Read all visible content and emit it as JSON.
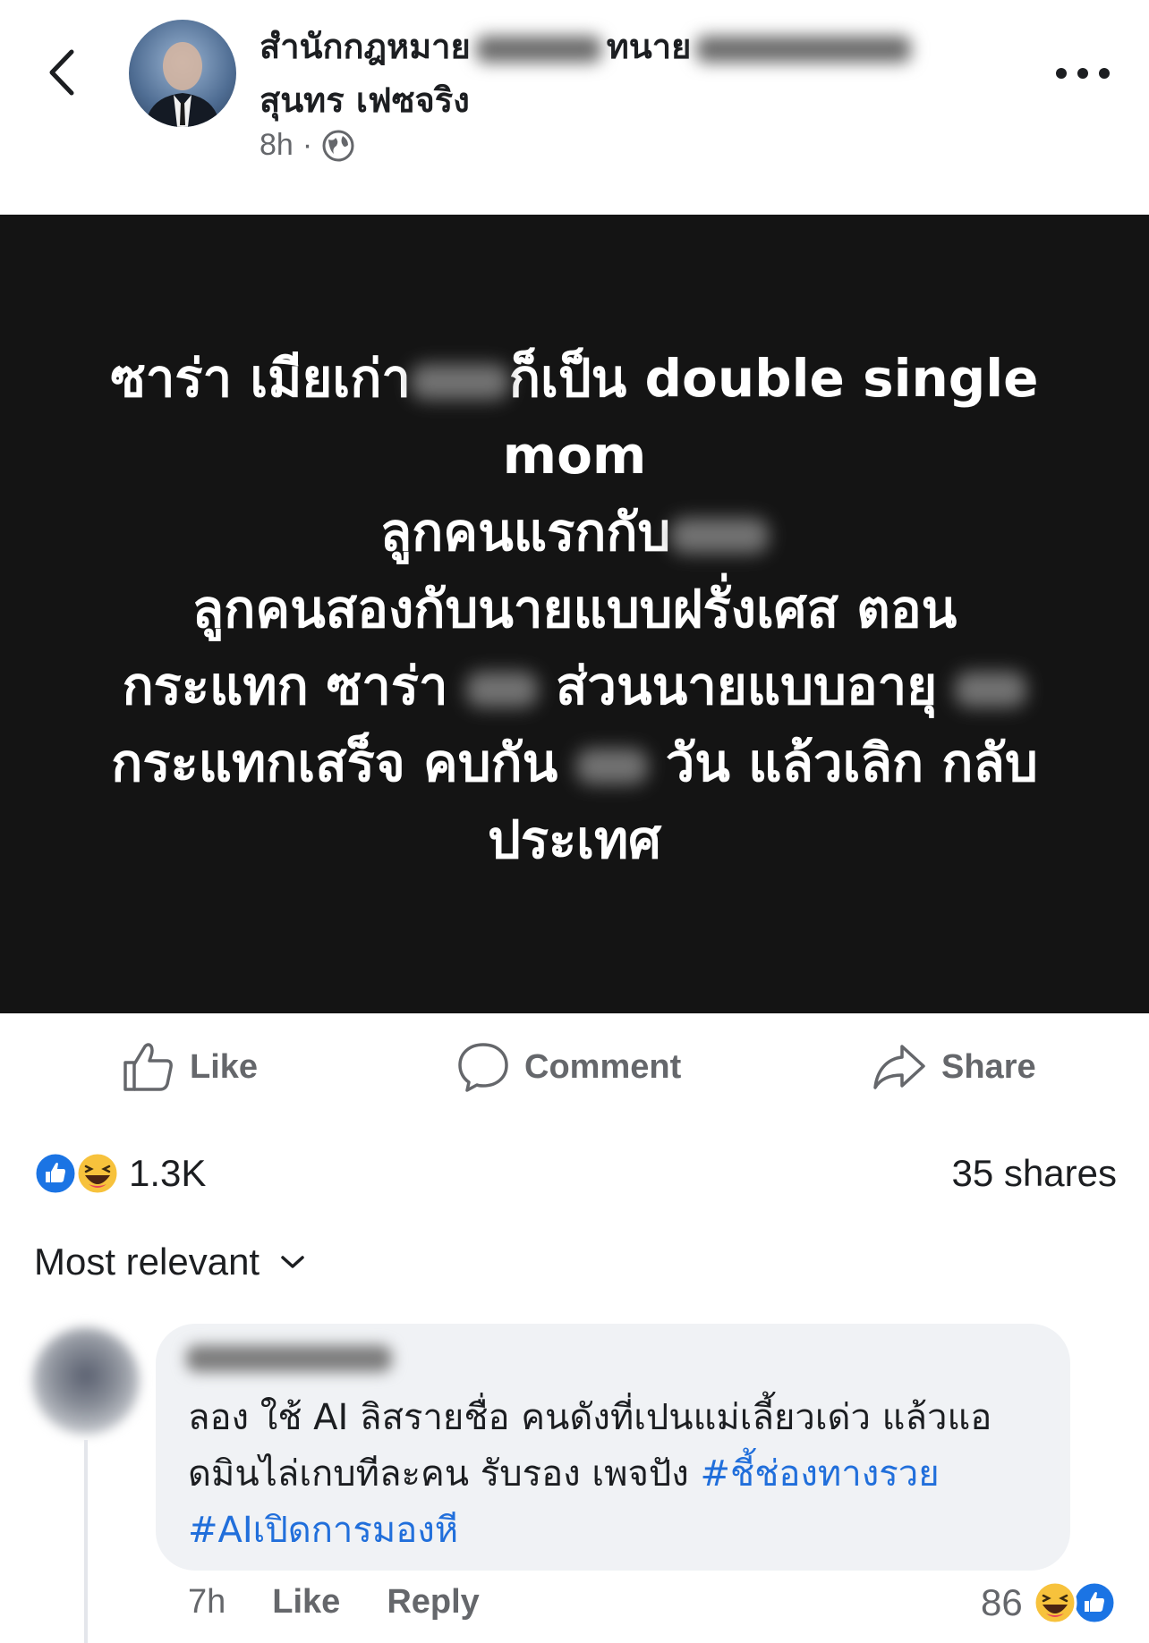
{
  "header": {
    "page_name_part1": "สำนักกฎหมาย",
    "page_name_part2": "ทนาย",
    "page_name_line2": "สุนทร เฟซจริง",
    "time": "8h",
    "separator": "·"
  },
  "post": {
    "l1a": "ซาร่า เมียเก่า",
    "l1b": "ก็เป็น double single",
    "l2": "mom",
    "l3": "ลูกคนแรกกับ",
    "l4": "ลูกคนสองกับนายแบบฝรั่งเศส ตอน",
    "l5a": "กระแทก ซาร่า",
    "l5b": "ส่วนนายแบบอายุ",
    "l6a": "กระแทกเสร็จ คบกัน",
    "l6b": "วัน แล้วเลิก กลับ",
    "l7": "ประเทศ"
  },
  "actions": {
    "like": "Like",
    "comment": "Comment",
    "share": "Share"
  },
  "stats": {
    "reactions": "1.3K",
    "shares": "35 shares"
  },
  "sort": {
    "label": "Most relevant"
  },
  "comment": {
    "author": "",
    "text_a": "ลอง ใช้ AI ลิสรายชื่อ คนดังที่เปนแม่เลี้ยวเด่ว แล้วแอ",
    "text_b": "ดมินไล่เกบทีละคน รับรอง เพจปัง ",
    "tag1": "#ชี้ช่องทางรวย",
    "tag2": "#AIเปิดการมองหี",
    "time": "7h",
    "like": "Like",
    "reply": "Reply",
    "reaction_count": "86"
  },
  "colors": {
    "accent": "#216fdb",
    "post_bg": "#141414",
    "muted": "#65676b",
    "bubble": "#f0f2f5"
  },
  "icons": [
    "chevron-left-icon",
    "globe-icon",
    "more-dots-icon",
    "thumbs-up-icon",
    "comment-bubble-icon",
    "share-arrow-icon",
    "like-reaction-icon",
    "haha-reaction-icon",
    "chevron-down-icon"
  ]
}
